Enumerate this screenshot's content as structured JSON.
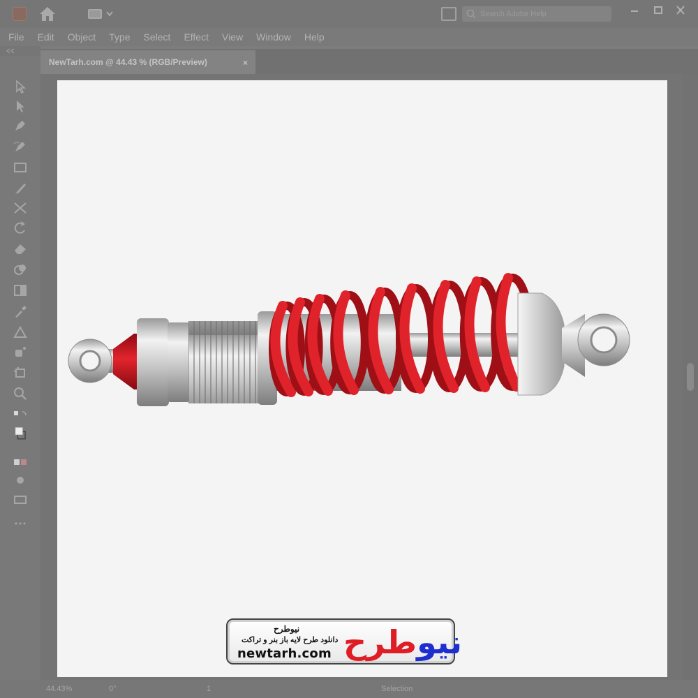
{
  "app": {
    "logo_icon": "illustrator-app-icon",
    "search_placeholder": "Search Adobe Help"
  },
  "menu": [
    "File",
    "Edit",
    "Object",
    "Type",
    "Select",
    "Effect",
    "View",
    "Window",
    "Help"
  ],
  "document_tab": {
    "title": "NewTarh.com @ 44.43 % (RGB/Preview)",
    "close_glyph": "×"
  },
  "tools": [
    "selection-tool-icon",
    "direct-selection-tool-icon",
    "pen-tool-icon",
    "curvature-tool-icon",
    "rectangle-tool-icon",
    "paintbrush-tool-icon",
    "width-tool-icon",
    "rotate-tool-icon",
    "eraser-tool-icon",
    "shape-builder-tool-icon",
    "gradient-tool-icon",
    "eyedropper-tool-icon",
    "blend-tool-icon",
    "symbol-sprayer-tool-icon",
    "artboard-tool-icon",
    "zoom-tool-icon",
    "swap-fill-stroke-icon",
    "fill-stroke-swatch-icon",
    "drawing-mode-icon",
    "screen-mode-icon",
    "edit-toolbar-icon"
  ],
  "status": {
    "zoom": "44.43%",
    "rotation": "0°",
    "page": "1",
    "mode": "Selection"
  },
  "artwork": {
    "subject": "shock-absorber-illustration",
    "spring_color": "#d0141e",
    "metal_color": "#b9b9b9"
  },
  "watermark": {
    "fa_title": "نیوطرح",
    "fa_tagline": "دانلود طرح لایه باز بنر و تراکت",
    "domain": "newtarh.com",
    "logo_part_blue": "نیو",
    "logo_part_red": "طرح"
  }
}
